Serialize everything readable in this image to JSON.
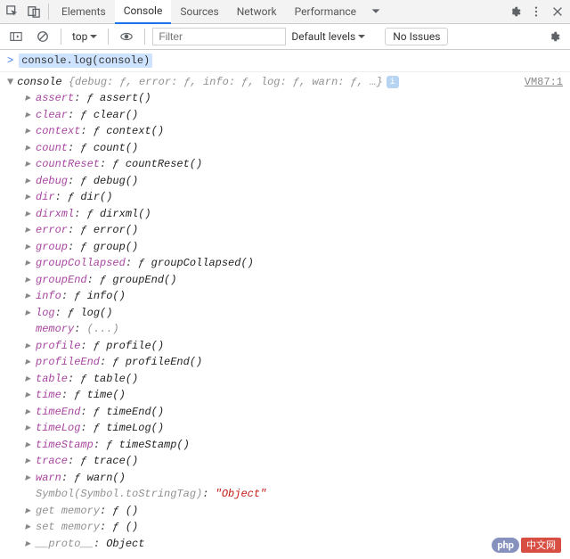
{
  "tabs": {
    "elements": "Elements",
    "console": "Console",
    "sources": "Sources",
    "network": "Network",
    "performance": "Performance"
  },
  "toolbar": {
    "context": "top",
    "filter_placeholder": "Filter",
    "levels_label": "Default levels",
    "no_issues": "No Issues"
  },
  "command": "console.log(console)",
  "source_link": "VM87:1",
  "summary": {
    "name": "console",
    "preview": "{debug: ƒ, error: ƒ, info: ƒ, log: ƒ, warn: ƒ, …}"
  },
  "props": [
    {
      "name": "assert",
      "type": "func",
      "val": "ƒ assert()"
    },
    {
      "name": "clear",
      "type": "func",
      "val": "ƒ clear()"
    },
    {
      "name": "context",
      "type": "func",
      "val": "ƒ context()"
    },
    {
      "name": "count",
      "type": "func",
      "val": "ƒ count()"
    },
    {
      "name": "countReset",
      "type": "func",
      "val": "ƒ countReset()"
    },
    {
      "name": "debug",
      "type": "func",
      "val": "ƒ debug()"
    },
    {
      "name": "dir",
      "type": "func",
      "val": "ƒ dir()"
    },
    {
      "name": "dirxml",
      "type": "func",
      "val": "ƒ dirxml()"
    },
    {
      "name": "error",
      "type": "func",
      "val": "ƒ error()"
    },
    {
      "name": "group",
      "type": "func",
      "val": "ƒ group()"
    },
    {
      "name": "groupCollapsed",
      "type": "func",
      "val": "ƒ groupCollapsed()"
    },
    {
      "name": "groupEnd",
      "type": "func",
      "val": "ƒ groupEnd()"
    },
    {
      "name": "info",
      "type": "func",
      "val": "ƒ info()"
    },
    {
      "name": "log",
      "type": "func",
      "val": "ƒ log()"
    },
    {
      "name": "memory",
      "type": "dim",
      "val": "(...)",
      "notri": true
    },
    {
      "name": "profile",
      "type": "func",
      "val": "ƒ profile()"
    },
    {
      "name": "profileEnd",
      "type": "func",
      "val": "ƒ profileEnd()"
    },
    {
      "name": "table",
      "type": "func",
      "val": "ƒ table()"
    },
    {
      "name": "time",
      "type": "func",
      "val": "ƒ time()"
    },
    {
      "name": "timeEnd",
      "type": "func",
      "val": "ƒ timeEnd()"
    },
    {
      "name": "timeLog",
      "type": "func",
      "val": "ƒ timeLog()"
    },
    {
      "name": "timeStamp",
      "type": "func",
      "val": "ƒ timeStamp()"
    },
    {
      "name": "trace",
      "type": "func",
      "val": "ƒ trace()"
    },
    {
      "name": "warn",
      "type": "func",
      "val": "ƒ warn()"
    },
    {
      "name": "Symbol(Symbol.toStringTag)",
      "type": "sym",
      "val": "\"Object\"",
      "notri": true
    },
    {
      "name": "get memory",
      "type": "dimfunc",
      "val": "ƒ ()"
    },
    {
      "name": "set memory",
      "type": "dimfunc",
      "val": "ƒ ()"
    },
    {
      "name": "__proto__",
      "type": "proto",
      "val": "Object"
    }
  ],
  "watermark": {
    "php": "php",
    "cn": "中文网"
  }
}
